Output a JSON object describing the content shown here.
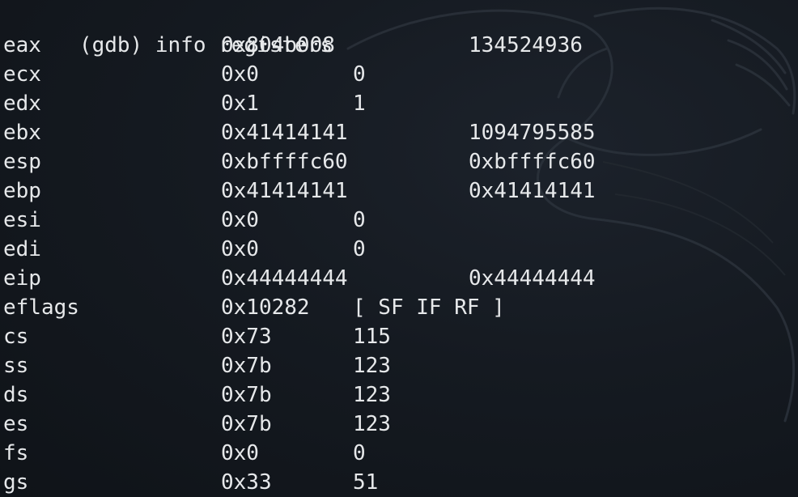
{
  "terminal": {
    "prompt": "(gdb)",
    "command": "info registers",
    "registers": [
      {
        "name": "eax",
        "hex": "0x804b008",
        "natural": "134524936",
        "col": "far"
      },
      {
        "name": "ecx",
        "hex": "0x0",
        "natural": "0",
        "col": "near"
      },
      {
        "name": "edx",
        "hex": "0x1",
        "natural": "1",
        "col": "near"
      },
      {
        "name": "ebx",
        "hex": "0x41414141",
        "natural": "1094795585",
        "col": "far"
      },
      {
        "name": "esp",
        "hex": "0xbffffc60",
        "natural": "0xbffffc60",
        "col": "far"
      },
      {
        "name": "ebp",
        "hex": "0x41414141",
        "natural": "0x41414141",
        "col": "far"
      },
      {
        "name": "esi",
        "hex": "0x0",
        "natural": "0",
        "col": "near"
      },
      {
        "name": "edi",
        "hex": "0x0",
        "natural": "0",
        "col": "near"
      },
      {
        "name": "eip",
        "hex": "0x44444444",
        "natural": "0x44444444",
        "col": "far"
      },
      {
        "name": "eflags",
        "hex": "0x10282",
        "natural": "[ SF IF RF ]",
        "col": "near"
      },
      {
        "name": "cs",
        "hex": "0x73",
        "natural": "115",
        "col": "near"
      },
      {
        "name": "ss",
        "hex": "0x7b",
        "natural": "123",
        "col": "near"
      },
      {
        "name": "ds",
        "hex": "0x7b",
        "natural": "123",
        "col": "near"
      },
      {
        "name": "es",
        "hex": "0x7b",
        "natural": "123",
        "col": "near"
      },
      {
        "name": "fs",
        "hex": "0x0",
        "natural": "0",
        "col": "near"
      },
      {
        "name": "gs",
        "hex": "0x33",
        "natural": "51",
        "col": "near"
      }
    ]
  },
  "colors": {
    "background": "#13171d",
    "text": "#e6e8ea",
    "watermark": "#2a313a"
  },
  "icons": {
    "watermark": "kali-dragon-icon"
  }
}
